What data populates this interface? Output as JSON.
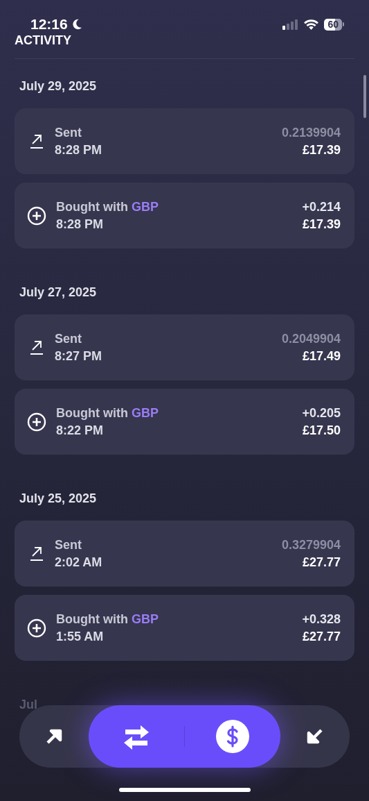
{
  "status_bar": {
    "time": "12:16",
    "battery": "60"
  },
  "header": {
    "title": "ACTIVITY"
  },
  "sections": [
    {
      "date": "July 29, 2025",
      "transactions": [
        {
          "kind": "sent",
          "label": "Sent",
          "time": "8:28 PM",
          "amount": "0.2139904",
          "value": "£17.39"
        },
        {
          "kind": "bought",
          "label": "Bought with",
          "currency": "GBP",
          "time": "8:28 PM",
          "amount": "+0.214",
          "value": "£17.39"
        }
      ]
    },
    {
      "date": "July 27, 2025",
      "transactions": [
        {
          "kind": "sent",
          "label": "Sent",
          "time": "8:27 PM",
          "amount": "0.2049904",
          "value": "£17.49"
        },
        {
          "kind": "bought",
          "label": "Bought with",
          "currency": "GBP",
          "time": "8:22 PM",
          "amount": "+0.205",
          "value": "£17.50"
        }
      ]
    },
    {
      "date": "July 25, 2025",
      "transactions": [
        {
          "kind": "sent",
          "label": "Sent",
          "time": "2:02 AM",
          "amount": "0.3279904",
          "value": "£27.77"
        },
        {
          "kind": "bought",
          "label": "Bought with",
          "currency": "GBP",
          "time": "1:55 AM",
          "amount": "+0.328",
          "value": "£27.77"
        }
      ]
    },
    {
      "date": "Jul"
    }
  ]
}
